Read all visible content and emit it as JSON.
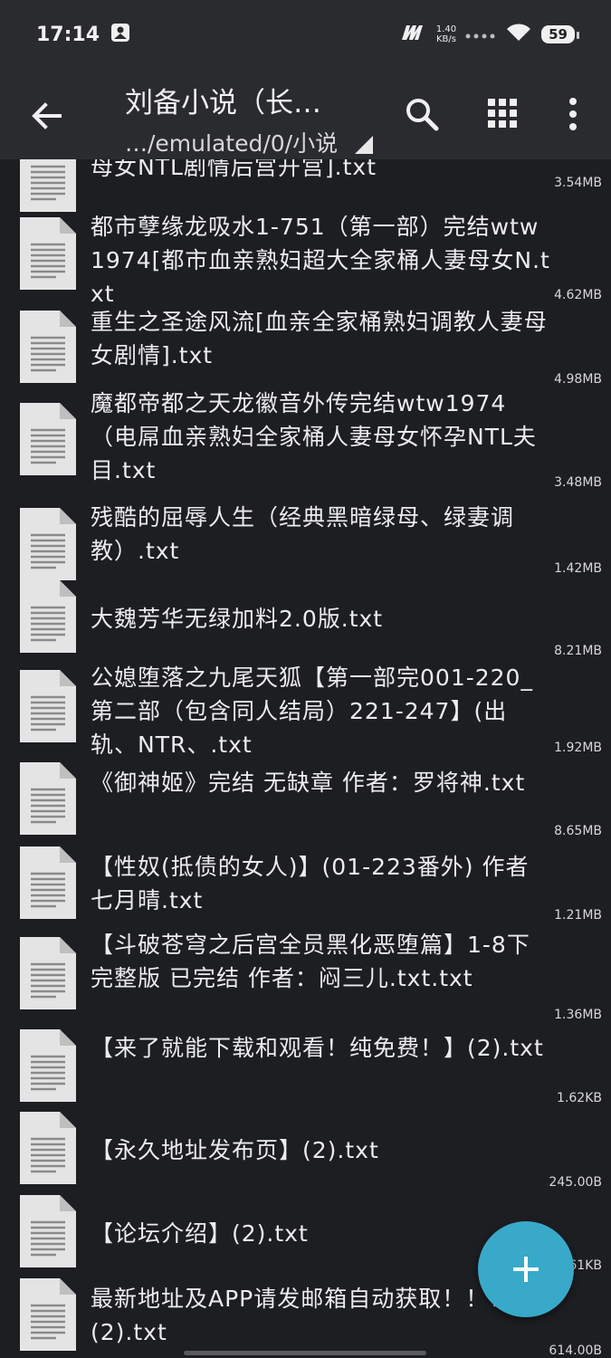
{
  "status": {
    "time": "17:14",
    "speed_value": "1.40",
    "speed_unit": "KB/s",
    "battery": "59"
  },
  "appbar": {
    "title": "刘备小说（长…",
    "path": "…/emulated/0/小说"
  },
  "files": [
    {
      "name": "母女NTL剧情后宫开宫].txt",
      "size": "3.54MB"
    },
    {
      "name": "都市孽缘龙吸水1-751（第一部）完结wtw1974[都市血亲熟妇超大全家桶人妻母女N.txt",
      "size": "4.62MB"
    },
    {
      "name": "重生之圣途风流[血亲全家桶熟妇调教人妻母女剧情].txt",
      "size": "4.98MB"
    },
    {
      "name": "魔都帝都之天龙徽音外传完结wtw1974（电屌血亲熟妇全家桶人妻母女怀孕NTL夫目.txt",
      "size": "3.48MB"
    },
    {
      "name": "残酷的屈辱人生（经典黑暗绿母、绿妻调教）.txt",
      "size": "1.42MB"
    },
    {
      "name": "大魏芳华无绿加料2.0版.txt",
      "size": "8.21MB"
    },
    {
      "name": "公媳堕落之九尾天狐【第一部完001-220_第二部（包含同人结局）221-247】(出轨、NTR、.txt",
      "size": "1.92MB"
    },
    {
      "name": "《御神姬》完结 无缺章 作者：罗将神.txt",
      "size": "8.65MB"
    },
    {
      "name": "【性奴(抵债的女人)】(01-223番外) 作者 七月晴.txt",
      "size": "1.21MB"
    },
    {
      "name": "【斗破苍穹之后宫全员黑化恶堕篇】1-8下完整版 已完结 作者：闷三儿.txt.txt",
      "size": "1.36MB"
    },
    {
      "name": "【来了就能下载和观看！纯免费！】(2).txt",
      "size": "1.62KB"
    },
    {
      "name": "【永久地址发布页】(2).txt",
      "size": "245.00B"
    },
    {
      "name": "【论坛介绍】(2).txt",
      "size": "1.61KB"
    },
    {
      "name": "最新地址及APP请发邮箱自动获取！！！(2).txt",
      "size": "614.00B"
    }
  ],
  "colors": {
    "background": "#1d1e22",
    "appbar": "#2a2b2f",
    "fab": "#38a9c9",
    "file_icon": "#e4e4e4"
  },
  "icons": {
    "back": "arrow-left-icon",
    "search": "search-icon",
    "view": "grid-view-icon",
    "more": "more-vertical-icon",
    "file": "text-file-icon",
    "fab": "plus-icon"
  }
}
